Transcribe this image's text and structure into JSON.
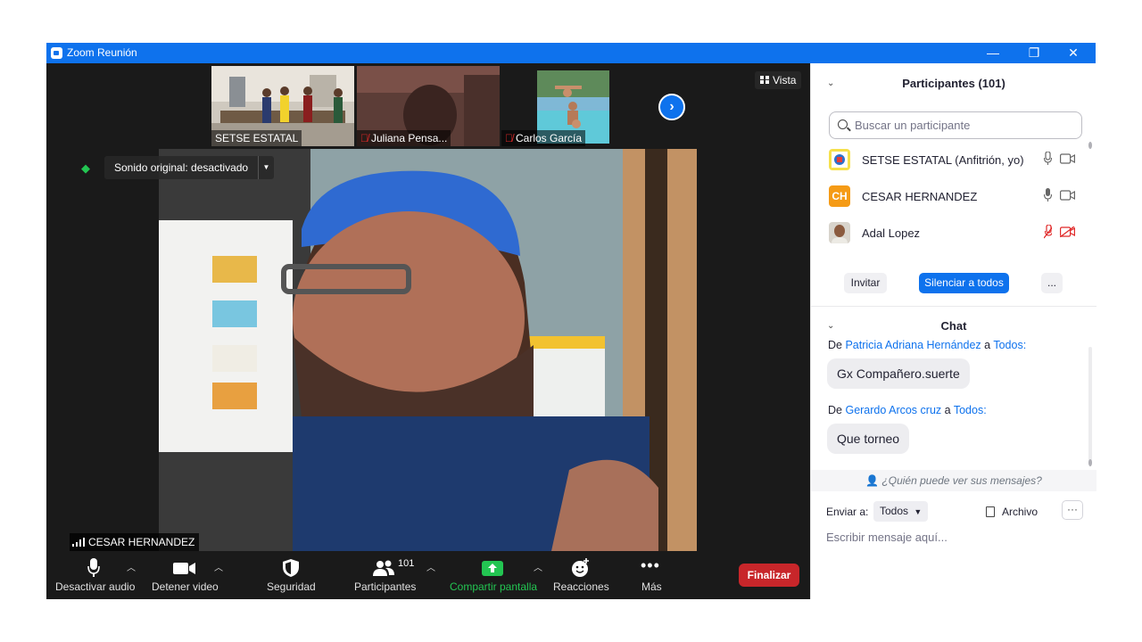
{
  "window": {
    "title": "Zoom Reunión",
    "controls": {
      "minimize": "—",
      "restore": "❐",
      "close": "✕"
    }
  },
  "thumbnails": [
    {
      "name": "SETSE ESTATAL",
      "muted": false
    },
    {
      "name": "Juliana Pensa...",
      "muted": true
    },
    {
      "name": "Carlos García",
      "muted": true
    }
  ],
  "view_button": {
    "label": "Vista",
    "icon": "grid-icon"
  },
  "main_video": {
    "sound_label": "Sonido original: desactivado",
    "speaker_name": "CESAR HERNANDEZ"
  },
  "toolbar": {
    "mute": "Desactivar audio",
    "video": "Detener video",
    "security": "Seguridad",
    "participants": "Participantes",
    "participants_count": "101",
    "share": "Compartir pantalla",
    "reactions": "Reacciones",
    "more": "Más",
    "end": "Finalizar"
  },
  "participants_panel": {
    "title": "Participantes (101)",
    "search_placeholder": "Buscar un participante",
    "participants": [
      {
        "name": "SETSE ESTATAL (Anfitrión, yo)",
        "avatar": "logo",
        "muted": false,
        "video_off": false
      },
      {
        "name": "CESAR HERNANDEZ",
        "avatar": "CH",
        "avatar_color": "#f59b16",
        "muted": false,
        "video_off": false
      },
      {
        "name": "Adal Lopez",
        "avatar": "photo",
        "muted": true,
        "video_off": true
      }
    ],
    "buttons": {
      "invite": "Invitar",
      "mute_all": "Silenciar a todos",
      "more": "..."
    }
  },
  "chat_panel": {
    "title": "Chat",
    "messages": [
      {
        "prefix": "De",
        "sender": "Patricia Adriana Hernández",
        "to_word": "a",
        "recipient": "Todos:",
        "text": "Gx Compañero.suerte"
      },
      {
        "prefix": "De",
        "sender": "Gerardo Arcos cruz",
        "to_word": "a",
        "recipient": "Todos:",
        "text": "Que torneo"
      }
    ],
    "who_can_see": "¿Quién puede ver sus mensajes?",
    "send_to_label": "Enviar a:",
    "send_to_value": "Todos",
    "file_label": "Archivo",
    "more": "···",
    "input_placeholder": "Escribir mensaje aquí..."
  },
  "colors": {
    "zoom_blue": "#0e72ed",
    "end_red": "#c8262a",
    "share_green": "#23c552",
    "mute_red": "#e02828"
  }
}
